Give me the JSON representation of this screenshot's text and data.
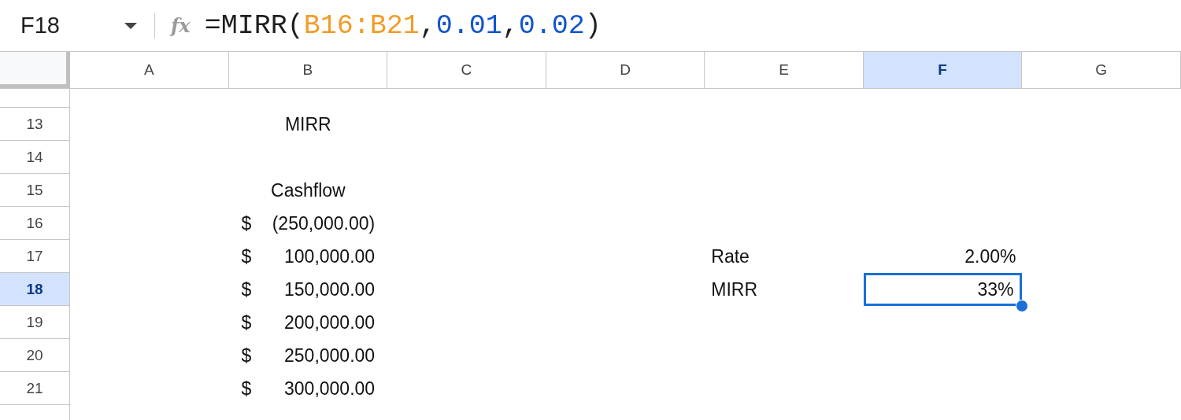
{
  "name_box": {
    "value": "F18"
  },
  "formula_bar": {
    "fx_label": "fx",
    "tokens": [
      {
        "text": "=MIRR(",
        "kind": "plain"
      },
      {
        "text": "B16:B21",
        "kind": "range"
      },
      {
        "text": ",",
        "kind": "plain"
      },
      {
        "text": "0.01",
        "kind": "number"
      },
      {
        "text": ",",
        "kind": "plain"
      },
      {
        "text": "0.02",
        "kind": "number"
      },
      {
        "text": ")",
        "kind": "plain"
      }
    ]
  },
  "columns": [
    {
      "label": "A",
      "selected": false
    },
    {
      "label": "B",
      "selected": false
    },
    {
      "label": "C",
      "selected": false
    },
    {
      "label": "D",
      "selected": false
    },
    {
      "label": "E",
      "selected": false
    },
    {
      "label": "F",
      "selected": true
    },
    {
      "label": "G",
      "selected": false
    }
  ],
  "rows": [
    {
      "number": "13",
      "selected": false,
      "column_b": {
        "kind": "title",
        "text": "MIRR",
        "selected": false
      }
    },
    {
      "number": "14",
      "selected": false
    },
    {
      "number": "15",
      "selected": false,
      "column_b": {
        "kind": "title",
        "text": "Cashflow",
        "selected": false
      }
    },
    {
      "number": "16",
      "selected": false,
      "column_b": {
        "kind": "currency",
        "symbol": "$",
        "amount": "(250,000.00)",
        "selected": false
      }
    },
    {
      "number": "17",
      "selected": false,
      "column_b": {
        "kind": "currency",
        "symbol": "$",
        "amount": "100,000.00",
        "selected": false
      },
      "column_e": {
        "kind": "label",
        "text": "Rate",
        "selected": false
      },
      "column_f": {
        "kind": "value",
        "text": "2.00%",
        "selected": false
      }
    },
    {
      "number": "18",
      "selected": true,
      "column_b": {
        "kind": "currency",
        "symbol": "$",
        "amount": "150,000.00",
        "selected": false
      },
      "column_e": {
        "kind": "label",
        "text": "MIRR",
        "selected": false
      },
      "column_f": {
        "kind": "value",
        "text": "33%",
        "selected": true
      }
    },
    {
      "number": "19",
      "selected": false,
      "column_b": {
        "kind": "currency",
        "symbol": "$",
        "amount": "200,000.00",
        "selected": false
      }
    },
    {
      "number": "20",
      "selected": false,
      "column_b": {
        "kind": "currency",
        "symbol": "$",
        "amount": "250,000.00",
        "selected": false
      }
    },
    {
      "number": "21",
      "selected": false,
      "column_b": {
        "kind": "currency",
        "symbol": "$",
        "amount": "300,000.00",
        "selected": false
      }
    }
  ]
}
